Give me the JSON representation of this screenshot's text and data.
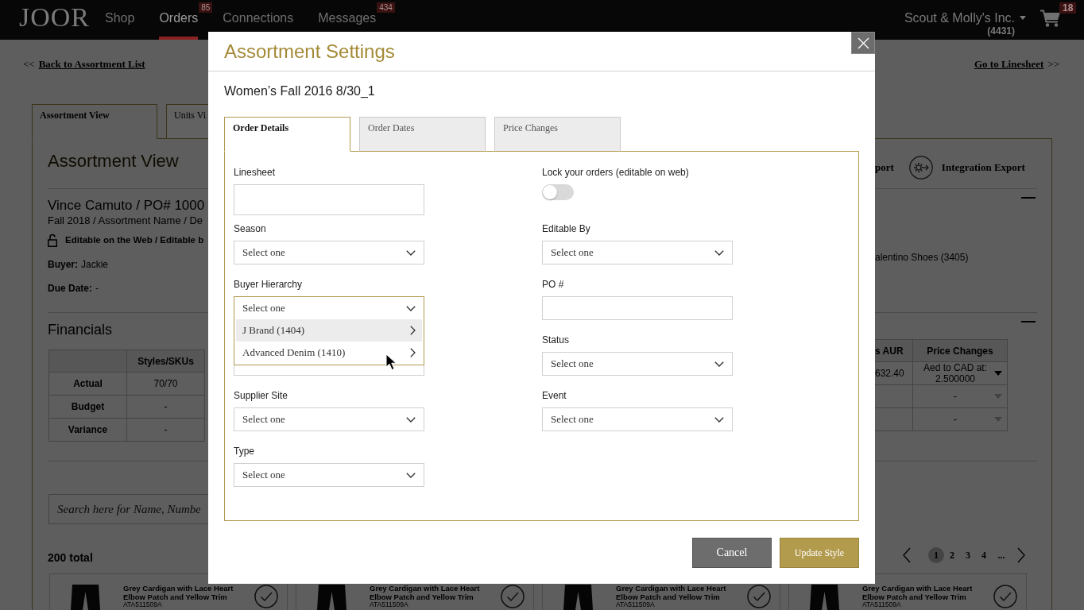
{
  "nav": {
    "logo": "JOOR",
    "items": [
      {
        "label": "Shop",
        "selected": false
      },
      {
        "label": "Orders",
        "selected": true,
        "badge": "85"
      },
      {
        "label": "Connections",
        "selected": false
      },
      {
        "label": "Messages",
        "selected": false,
        "badge": "434"
      }
    ],
    "account": {
      "name": "Scout & Molly's Inc.",
      "number": "(4431)"
    },
    "cart": {
      "badge": "18"
    }
  },
  "page": {
    "back_link": {
      "arrows": "<<",
      "label": "Back to Assortment List"
    },
    "forward_link": {
      "label": "Go to Linesheet",
      "arrows": ">>"
    },
    "tabs": [
      {
        "label": "Assortment View",
        "selected": true
      },
      {
        "label": "Units Vi",
        "selected": false
      }
    ],
    "title": "Assortment View",
    "actions": [
      {
        "label": "port",
        "kind": "text"
      },
      {
        "label": "Integration Export",
        "kind": "icon"
      }
    ],
    "order": {
      "heading": "Vince Camuto / PO# 1000",
      "subheading": "Fall 2018 / Assortment Name / De",
      "editable": "Editable on the Web / Editable b",
      "fields": [
        {
          "label": "Buyer:",
          "value": "Jackie"
        },
        {
          "label": "Due Date:",
          "value": "-"
        }
      ],
      "side_text": "alentino Shoes (3405)"
    },
    "financials": {
      "title": "Financials",
      "left_table": {
        "columns": [
          "Styles/SKUs"
        ],
        "rows": [
          {
            "label": "Actual",
            "cells": [
              "70/70"
            ]
          },
          {
            "label": "Budget",
            "cells": [
              "-"
            ]
          },
          {
            "label": "Variance",
            "cells": [
              "-"
            ]
          }
        ]
      },
      "right_table": {
        "columns": [
          "s AUR",
          "Price Changes"
        ],
        "rows": [
          {
            "aur": "632.40",
            "price_change": "Aed to CAD at: 2.500000",
            "disabled": false
          },
          {
            "price_change": "-",
            "disabled": true
          },
          {
            "price_change": "-",
            "disabled": true
          }
        ]
      }
    },
    "search": {
      "placeholder": "Search here for Name, Numbe"
    },
    "total": "200 total",
    "pagination": {
      "pages": [
        {
          "label": "1",
          "selected": true
        },
        {
          "label": "2",
          "selected": false
        },
        {
          "label": "3",
          "selected": false
        },
        {
          "label": "4",
          "selected": false
        }
      ],
      "more": "..."
    },
    "products": [
      {
        "name": "Grey Cardigan with Lace Heart Elbow Patch and Yellow Trim",
        "sku": "ATA511509A"
      },
      {
        "name": "Grey Cardigan with Lace Heart Elbow Patch and Yellow Trim",
        "sku": "ATA511509A"
      },
      {
        "name": "Grey Cardigan with Lace Heart Elbow Patch and Yellow Trim",
        "sku": "ATA511509A"
      },
      {
        "name": "Grey Cardigan with Lace Heart Elbow Patch and Yellow Trim",
        "sku": "ATA511509A"
      }
    ]
  },
  "modal": {
    "title": "Assortment Settings",
    "subtitle": "Women’s Fall 2016 8/30_1",
    "tabs": [
      {
        "label": "Order Details",
        "selected": true
      },
      {
        "label": "Order Dates",
        "selected": false
      },
      {
        "label": "Price Changes",
        "selected": false
      }
    ],
    "columns": [
      [
        {
          "kind": "text",
          "label": "Linesheet"
        },
        {
          "kind": "select",
          "label": "Season",
          "placeholder": "Select one",
          "expanded": false
        },
        {
          "kind": "select",
          "label": "Buyer Hierarchy",
          "placeholder": "Select one",
          "expanded": true,
          "options": [
            {
              "label": "J Brand (1404)",
              "selected": true
            },
            {
              "label": "Advanced Denim (1410)",
              "selected": false
            }
          ]
        },
        {
          "kind": "select",
          "expanded": false
        },
        {
          "kind": "select",
          "label": "Supplier Site",
          "placeholder": "Select one",
          "expanded": false
        },
        {
          "kind": "select",
          "label": "Type",
          "placeholder": "Select one",
          "expanded": false
        }
      ],
      [
        {
          "kind": "toggle",
          "label": "Lock your orders (editable on web)",
          "on": false
        },
        {
          "kind": "select",
          "label": "Editable By",
          "placeholder": "Select one",
          "expanded": false
        },
        {
          "kind": "text",
          "label": "PO #"
        },
        {
          "kind": "select",
          "label": "Status",
          "placeholder": "Select one",
          "expanded": false
        },
        {
          "kind": "select",
          "label": "Event",
          "placeholder": "Select one",
          "expanded": false
        }
      ]
    ],
    "buttons": [
      {
        "label": "Cancel",
        "kind": "secondary"
      },
      {
        "label": "Update Style",
        "kind": "primary"
      }
    ]
  }
}
